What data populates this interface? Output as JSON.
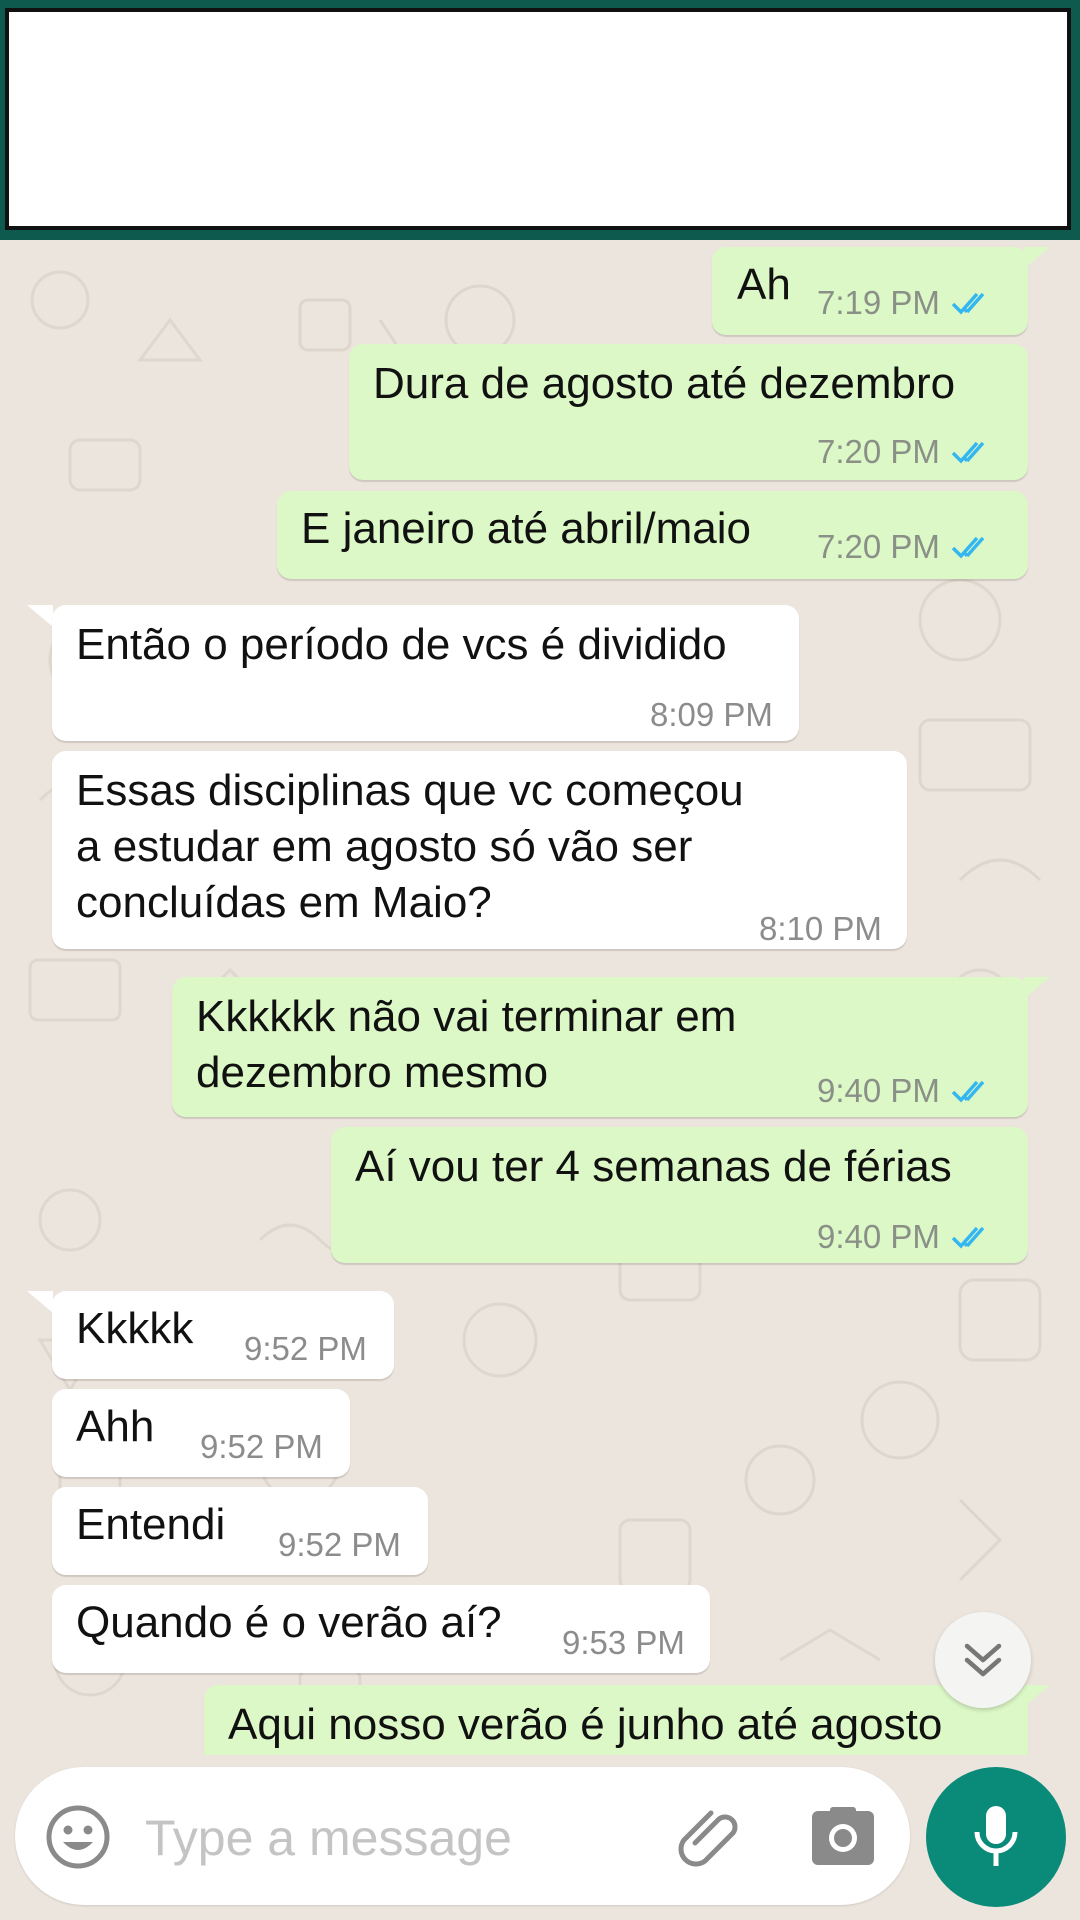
{
  "input": {
    "placeholder": "Type a message"
  },
  "icons": {
    "emoji": "emoji-icon",
    "attach": "paperclip-icon",
    "camera": "camera-icon",
    "mic": "microphone-icon",
    "scroll": "double-chevron-down-icon",
    "read_receipt": "double-check-icon"
  },
  "colors": {
    "outgoing_bubble": "#dcf8c6",
    "incoming_bubble": "#ffffff",
    "accent": "#0a8a78",
    "read_ticks": "#34b7f1",
    "header": "#0f5a4f"
  },
  "messages": [
    {
      "direction": "out",
      "text": "Ah",
      "time": "7:19 PM",
      "read": true
    },
    {
      "direction": "out",
      "text": "Dura de agosto até dezembro",
      "time": "7:20 PM",
      "read": true
    },
    {
      "direction": "out",
      "text": "E janeiro até abril/maio",
      "time": "7:20 PM",
      "read": true
    },
    {
      "direction": "in",
      "text": "Então o período de vcs é dividido",
      "time": "8:09 PM"
    },
    {
      "direction": "in",
      "text": "Essas disciplinas que vc começou\na estudar em agosto só vão ser\nconcluídas em Maio?",
      "time": "8:10 PM"
    },
    {
      "direction": "out",
      "text": "Kkkkkk não vai terminar em\ndezembro mesmo",
      "time": "9:40 PM",
      "read": true
    },
    {
      "direction": "out",
      "text": "Aí vou ter 4 semanas de férias",
      "time": "9:40 PM",
      "read": true
    },
    {
      "direction": "in",
      "text": "Kkkkk",
      "time": "9:52 PM"
    },
    {
      "direction": "in",
      "text": "Ahh",
      "time": "9:52 PM"
    },
    {
      "direction": "in",
      "text": "Entendi",
      "time": "9:52 PM"
    },
    {
      "direction": "in",
      "text": "Quando é o verão aí?",
      "time": "9:53 PM"
    },
    {
      "direction": "out",
      "text": "Aqui nosso verão é junho até agosto",
      "time": "",
      "read": false
    }
  ]
}
